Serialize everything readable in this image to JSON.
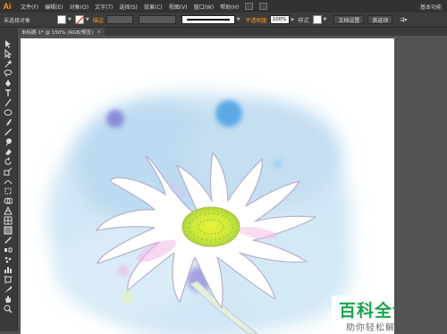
{
  "app": {
    "logo": "Ai",
    "workspace": "基本功能"
  },
  "menu": {
    "items": [
      "文件(F)",
      "编辑(E)",
      "对象(O)",
      "文字(T)",
      "选择(S)",
      "效果(C)",
      "视图(V)",
      "窗口(W)",
      "帮助(H)"
    ]
  },
  "controlbar": {
    "selection_label": "未选择对象",
    "stroke_label": "描边",
    "opacity_label": "不透明度",
    "opacity_value": "100%",
    "style_label": "样式",
    "doc_settings": "文档设置",
    "preferences": "首选项"
  },
  "document": {
    "tab_title": "未标题-1* @ 150% (RGB/预览)",
    "close_glyph": "×"
  },
  "watermark": {
    "main": "百科全说",
    "sub": "助你轻松解决"
  },
  "tools": [
    "selection-tool",
    "direct-selection-tool",
    "magic-wand-tool",
    "lasso-tool",
    "pen-tool",
    "type-tool",
    "line-tool",
    "ellipse-tool",
    "paintbrush-tool",
    "pencil-tool",
    "blob-brush-tool",
    "eraser-tool",
    "rotate-tool",
    "scale-tool",
    "warp-tool",
    "free-transform-tool",
    "shape-builder-tool",
    "perspective-grid-tool",
    "mesh-tool",
    "gradient-tool",
    "eyedropper-tool",
    "blend-tool",
    "symbol-sprayer-tool",
    "column-graph-tool",
    "artboard-tool",
    "slice-tool",
    "hand-tool",
    "zoom-tool"
  ],
  "colors": {
    "accent": "#ff9a00",
    "watermark_green": "#1aa54a"
  }
}
